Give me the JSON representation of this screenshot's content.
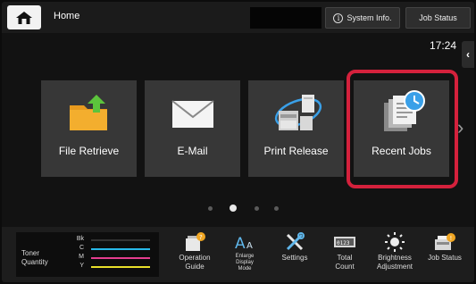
{
  "header": {
    "home_title": "Home",
    "system_info_label": "System Info.",
    "job_status_label": "Job Status",
    "clock": "17:24"
  },
  "tiles": [
    {
      "label": "File Retrieve",
      "icon": "folder-upload-icon"
    },
    {
      "label": "E-Mail",
      "icon": "envelope-icon"
    },
    {
      "label": "Print Release",
      "icon": "printer-network-icon"
    },
    {
      "label": "Recent Jobs",
      "icon": "document-clock-icon"
    }
  ],
  "pagination": {
    "pages": 4,
    "current": 2
  },
  "toner": {
    "label_line1": "Toner",
    "label_line2": "Quantity",
    "channels": [
      {
        "name": "Bk",
        "color": "#111111"
      },
      {
        "name": "C",
        "color": "#28b8e8"
      },
      {
        "name": "M",
        "color": "#e43d8f"
      },
      {
        "name": "Y",
        "color": "#e8e02a"
      }
    ]
  },
  "shortcuts": [
    {
      "line1": "Operation",
      "line2": "Guide",
      "icon": "operation-guide-icon"
    },
    {
      "line1": "Enlarge",
      "line2": "Display",
      "line3": "Mode",
      "icon": "enlarge-text-icon"
    },
    {
      "line1": "Settings",
      "icon": "settings-tools-icon"
    },
    {
      "line1": "Total",
      "line2": "Count",
      "icon": "counter-icon"
    },
    {
      "line1": "Brightness",
      "line2": "Adjustment",
      "icon": "brightness-icon"
    },
    {
      "line1": "Job Status",
      "icon": "job-status-icon"
    }
  ],
  "colors": {
    "highlight": "#d4213c",
    "folder": "#f0a623",
    "accent_green": "#5cc43c",
    "clock_blue": "#3aa0e8"
  }
}
